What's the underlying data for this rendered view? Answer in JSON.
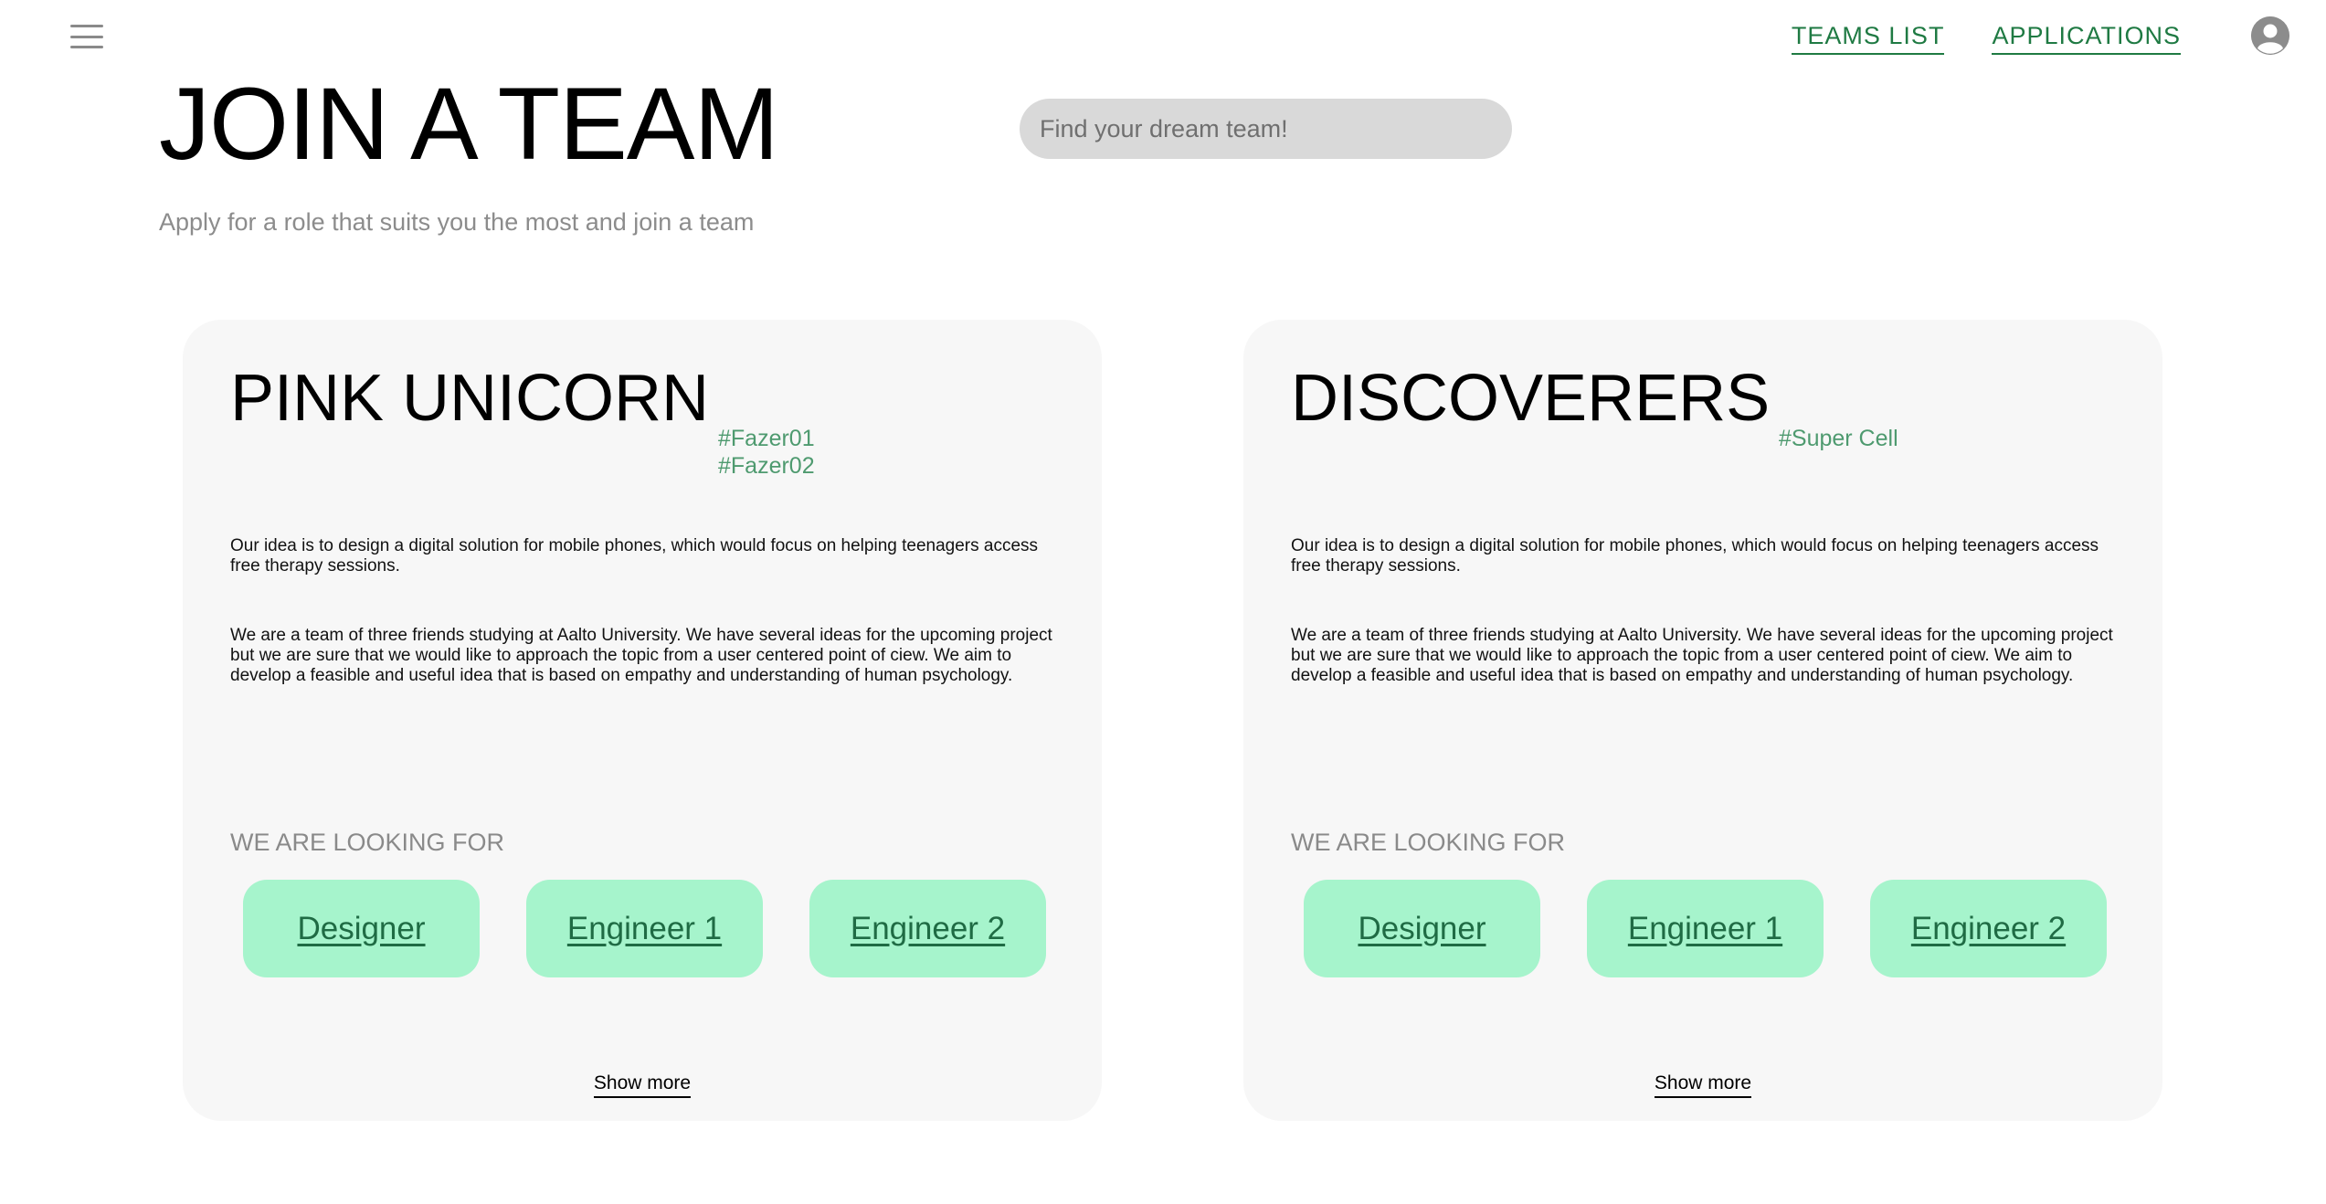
{
  "nav": {
    "links": [
      {
        "label": "TEAMS LIST"
      },
      {
        "label": "APPLICATIONS"
      }
    ]
  },
  "header": {
    "title": "JOIN A TEAM",
    "subtitle": "Apply for a role that suits you the most and join a team"
  },
  "search": {
    "placeholder": "Find your dream team!",
    "value": ""
  },
  "looking_for_label": "WE ARE LOOKING FOR",
  "show_more_label": "Show more",
  "teams": [
    {
      "name": "PINK UNICORN",
      "tags": [
        "#Fazer01",
        "#Fazer02"
      ],
      "description_1": "Our idea is to design a digital solution for mobile phones, which would focus on helping teenagers access free therapy sessions.",
      "description_2": "We are a team of three friends studying at Aalto University. We have several ideas for the upcoming project but we are sure that we would like to approach the topic from a user centered point of ciew. We aim to develop a feasible and useful idea that is based on empathy and understanding of human psychology.",
      "roles": [
        "Designer",
        "Engineer 1",
        "Engineer 2"
      ]
    },
    {
      "name": "DISCOVERERS",
      "tags": [
        "#Super Cell"
      ],
      "description_1": "Our idea is to design a digital solution for mobile phones, which would focus on helping teenagers access free therapy sessions.",
      "description_2": "We are a team of three friends studying at Aalto University. We have several ideas for the upcoming project but we are sure that we would like to approach the topic from a user centered point of ciew. We aim to develop a feasible and useful idea that is based on empathy and understanding of human psychology.",
      "roles": [
        "Designer",
        "Engineer 1",
        "Engineer 2"
      ]
    }
  ],
  "colors": {
    "accent_green": "#1f7a43",
    "tag_green": "#4e9a6f",
    "role_bg": "#a6f4cc",
    "card_bg": "#f7f7f7",
    "search_bg": "#d9d9d9"
  },
  "icons": {
    "menu": "hamburger-menu-icon",
    "profile": "user-avatar-icon"
  }
}
